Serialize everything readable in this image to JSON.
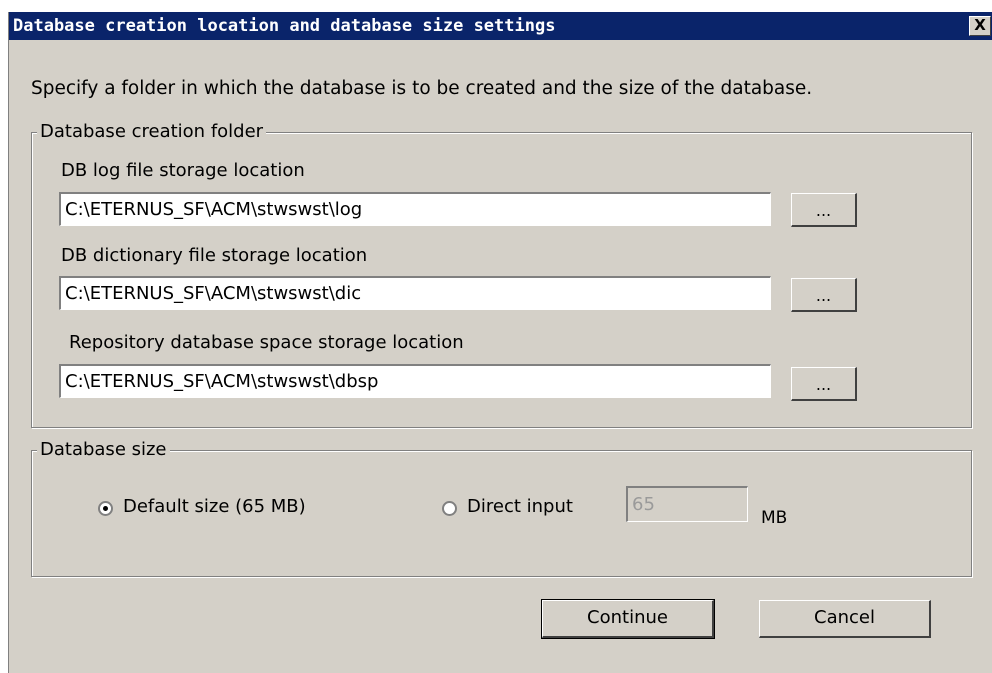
{
  "dialog": {
    "title": "Database creation location and database size settings",
    "close_glyph": "X",
    "description": "Specify a folder in which the database is to be created and the size of the database."
  },
  "folder_group": {
    "legend": "Database creation folder",
    "log": {
      "label": "DB log file storage location",
      "value": "C:\\ETERNUS_SF\\ACM\\stwswst\\log",
      "browse_label": "..."
    },
    "dic": {
      "label": "DB dictionary file storage location",
      "value": "C:\\ETERNUS_SF\\ACM\\stwswst\\dic",
      "browse_label": "..."
    },
    "dbsp": {
      "label": "Repository database space storage location",
      "value": "C:\\ETERNUS_SF\\ACM\\stwswst\\dbsp",
      "browse_label": "..."
    }
  },
  "size_group": {
    "legend": "Database size",
    "default_option": {
      "label": "Default size (65 MB)",
      "checked": true
    },
    "direct_option": {
      "label": "Direct input",
      "checked": false
    },
    "direct_value": "65",
    "unit": "MB"
  },
  "buttons": {
    "continue": "Continue",
    "cancel": "Cancel"
  },
  "colors": {
    "titlebar": "#0a246a",
    "dialog_bg": "#d4d0c8"
  }
}
